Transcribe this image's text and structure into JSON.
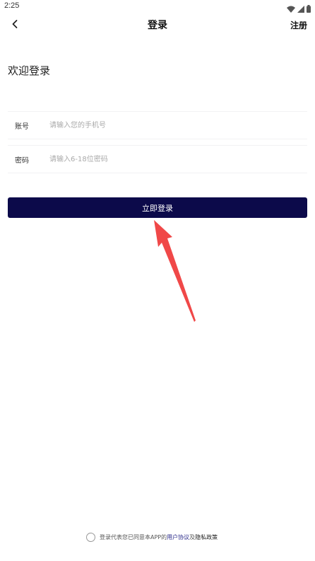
{
  "status_bar": {
    "time": "2:25"
  },
  "header": {
    "title": "登录",
    "register_label": "注册"
  },
  "welcome": {
    "title": "欢迎登录"
  },
  "form": {
    "account": {
      "label": "账号",
      "placeholder": "请输入您的手机号",
      "value": ""
    },
    "password": {
      "label": "密码",
      "placeholder": "请输入6-18位密码",
      "value": ""
    }
  },
  "login_button": {
    "label": "立即登录",
    "color": "#0c0a4a"
  },
  "annotation": {
    "arrow_color": "#f04848"
  },
  "agreement": {
    "prefix": "登录代表您已同意本APP的",
    "user_agreement": "用户协议",
    "conjunction": "及",
    "privacy_policy": "隐私政策",
    "checked": false
  }
}
